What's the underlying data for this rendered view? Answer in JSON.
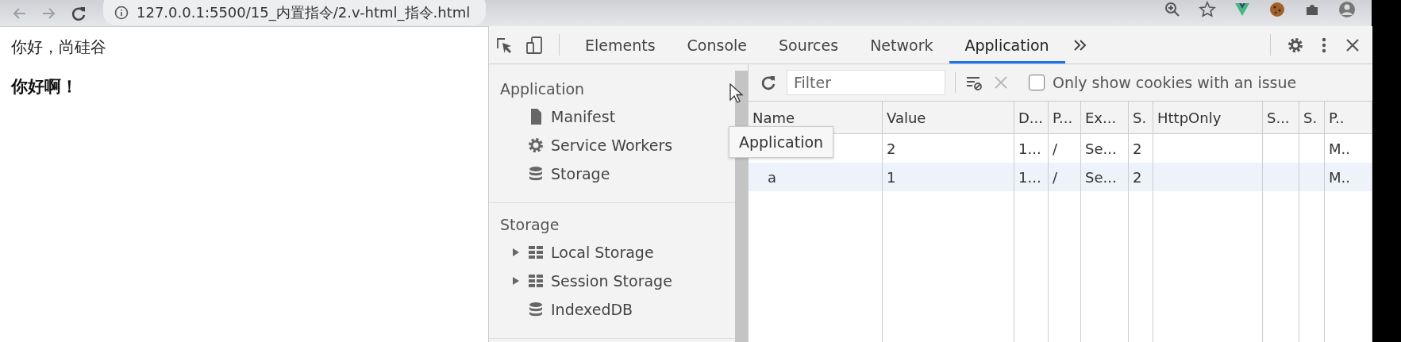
{
  "browser": {
    "url": "127.0.0.1:5500/15_内置指令/2.v-html_指令.html"
  },
  "page": {
    "greeting": "你好，尚硅谷",
    "heading": "你好啊！"
  },
  "devtools": {
    "tabs": [
      {
        "label": "Elements",
        "selected": false
      },
      {
        "label": "Console",
        "selected": false
      },
      {
        "label": "Sources",
        "selected": false
      },
      {
        "label": "Network",
        "selected": false
      },
      {
        "label": "Application",
        "selected": true
      }
    ],
    "sidebar": [
      {
        "title": "Application",
        "items": [
          {
            "label": "Manifest",
            "kind": "file"
          },
          {
            "label": "Service Workers",
            "kind": "gear"
          },
          {
            "label": "Storage",
            "kind": "database"
          }
        ]
      },
      {
        "title": "Storage",
        "items": [
          {
            "label": "Local Storage",
            "kind": "table",
            "expanded": false
          },
          {
            "label": "Session Storage",
            "kind": "table",
            "expanded": false
          },
          {
            "label": "IndexedDB",
            "kind": "database"
          }
        ]
      }
    ],
    "toolbar": {
      "filter_placeholder": "Filter",
      "issue_filter": {
        "label": "Only show cookies with an issue",
        "checked": false
      }
    },
    "table": {
      "columns": [
        "Name",
        "Value",
        "D...",
        "P...",
        "Ex...",
        "S.",
        "HttpOnly",
        "S...",
        "S.",
        "P.."
      ],
      "rows": [
        {
          "cells": [
            null,
            "2",
            "1...",
            "/",
            "Se...",
            "2",
            null,
            null,
            null,
            "M.."
          ]
        },
        {
          "cells": [
            "a",
            "1",
            "1...",
            "/",
            "Se...",
            "2",
            null,
            null,
            null,
            "M.."
          ]
        }
      ]
    },
    "tooltip": "Application"
  }
}
